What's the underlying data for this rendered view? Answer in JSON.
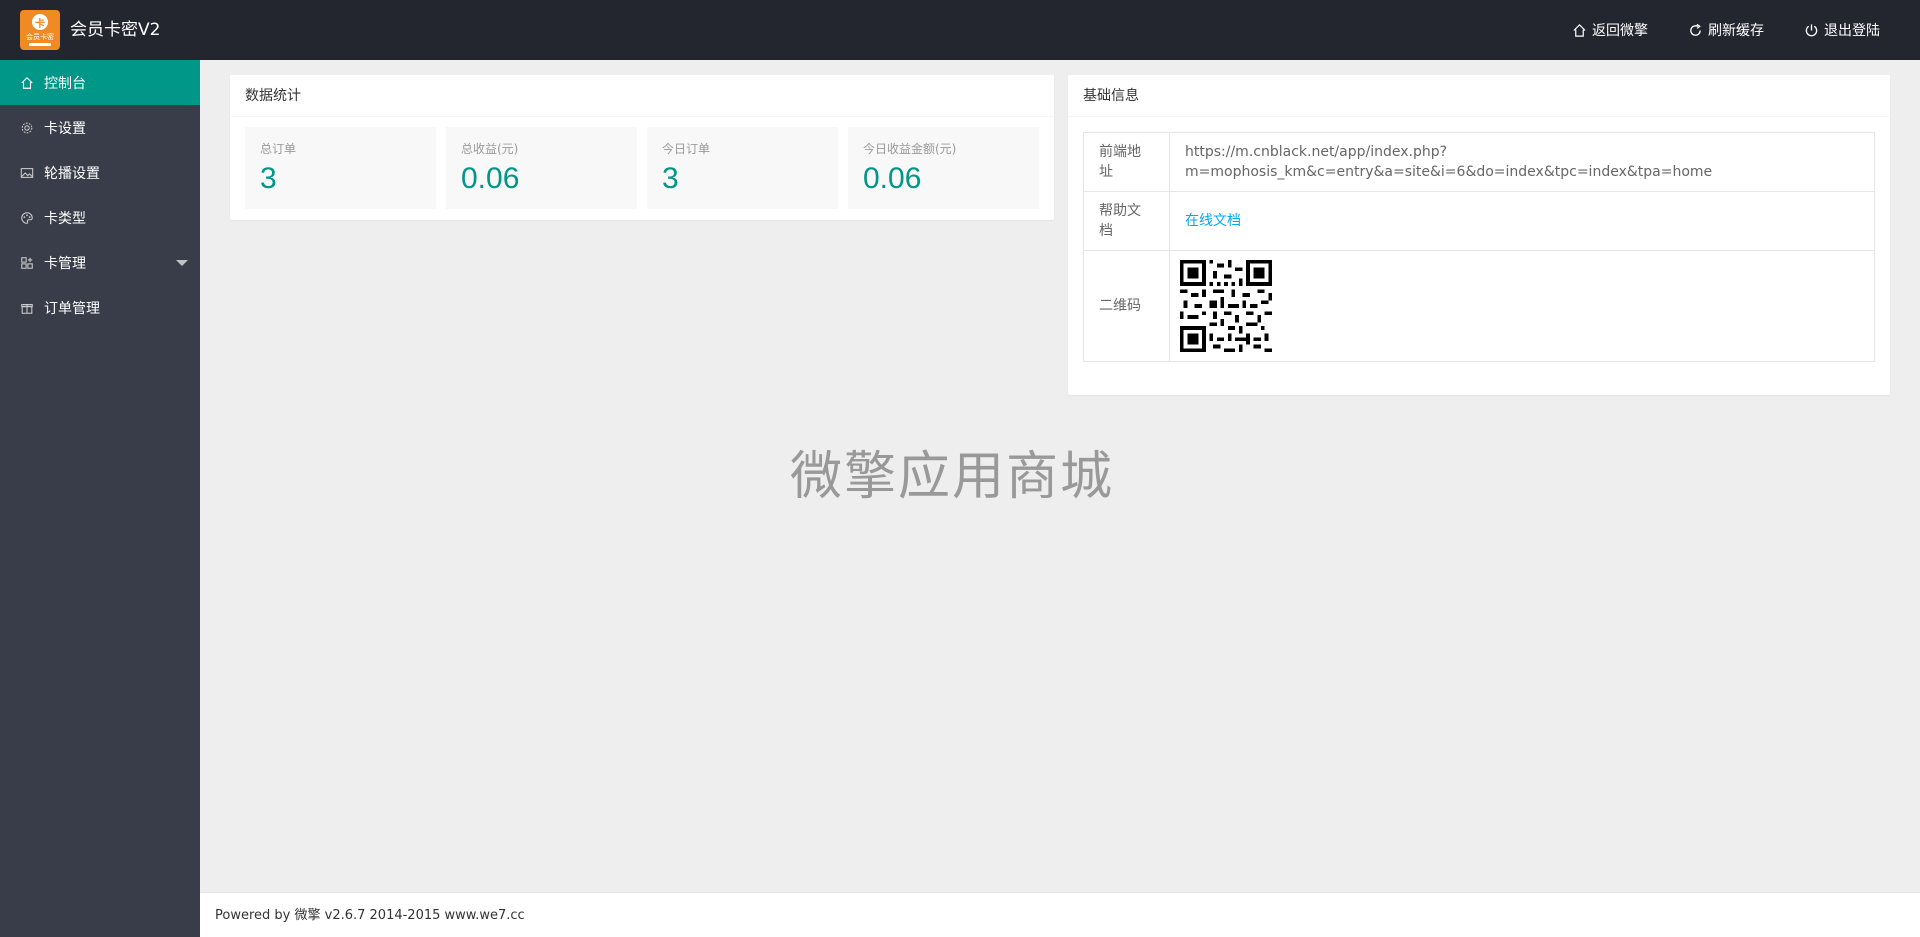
{
  "app": {
    "title": "会员卡密V2",
    "logo_text": "会员卡密",
    "logo_glyph": "卡"
  },
  "topbar": {
    "actions": [
      {
        "label": "返回微擎",
        "icon": "home-icon"
      },
      {
        "label": "刷新缓存",
        "icon": "refresh-icon"
      },
      {
        "label": "退出登陆",
        "icon": "power-icon"
      }
    ]
  },
  "sidebar": {
    "items": [
      {
        "label": "控制台",
        "icon": "home-icon",
        "active": true
      },
      {
        "label": "卡设置",
        "icon": "gear-icon"
      },
      {
        "label": "轮播设置",
        "icon": "image-icon"
      },
      {
        "label": "卡类型",
        "icon": "palette-icon"
      },
      {
        "label": "卡管理",
        "icon": "apps-icon",
        "has_submenu": true
      },
      {
        "label": "订单管理",
        "icon": "gift-icon"
      }
    ]
  },
  "stats": {
    "title": "数据统计",
    "items": [
      {
        "label": "总订单",
        "value": "3"
      },
      {
        "label": "总收益(元)",
        "value": "0.06"
      },
      {
        "label": "今日订单",
        "value": "3"
      },
      {
        "label": "今日收益金额(元)",
        "value": "0.06"
      }
    ]
  },
  "info": {
    "title": "基础信息",
    "rows": [
      {
        "key": "前端地址",
        "value": "https://m.cnblack.net/app/index.php?m=mophosis_km&c=entry&a=site&i=6&do=index&tpc=index&tpa=home"
      },
      {
        "key": "帮助文档",
        "value": "在线文档"
      },
      {
        "key": "二维码",
        "value": ""
      }
    ]
  },
  "watermark": "微擎应用商城",
  "footer": {
    "prefix": "Powered by ",
    "brand": "微擎",
    "version": " v2.6.7 2014-2015 ",
    "link": "www.we7.cc"
  },
  "colors": {
    "topbar_bg": "#23262e",
    "sidebar_bg": "#393d49",
    "accent": "#009688",
    "link": "#01AAED",
    "logo_bg": "#f08a24"
  }
}
